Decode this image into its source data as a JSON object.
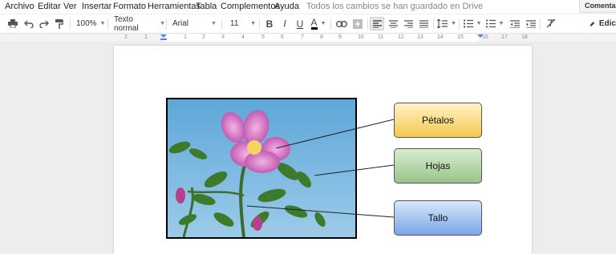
{
  "menu": [
    "Archivo",
    "Editar",
    "Ver",
    "Insertar",
    "Formato",
    "Herramientas",
    "Tabla",
    "Complementos",
    "Ayuda"
  ],
  "save_status": "Todos los cambios se han guardado en Drive",
  "comments_label": "Comentarios",
  "toolbar": {
    "zoom": "100%",
    "style": "Texto normal",
    "font": "Arial",
    "size": "11",
    "edit_label": "Edic",
    "icons": [
      "print-icon",
      "undo-icon",
      "redo-icon",
      "paint-format-icon",
      "bold-icon",
      "italic-icon",
      "underline-icon",
      "text-color-icon",
      "link-icon",
      "insert-comment-icon",
      "align-left-icon",
      "align-center-icon",
      "align-right-icon",
      "justify-icon",
      "line-spacing-icon",
      "numbered-list-icon",
      "bulleted-list-icon",
      "decrease-indent-icon",
      "increase-indent-icon",
      "clear-formatting-icon",
      "pencil-icon"
    ]
  },
  "ruler": {
    "labels": [
      "2",
      "1",
      "1",
      "2",
      "3",
      "4",
      "5",
      "6",
      "7",
      "8",
      "9",
      "10",
      "11",
      "12",
      "13",
      "14",
      "15",
      "16",
      "17",
      "18"
    ]
  },
  "diagram": {
    "labels": [
      "Pétalos",
      "Hojas",
      "Tallo"
    ],
    "colors": {
      "petalos": "#f3c94e",
      "hojas": "#99c489",
      "tallo": "#7aa6e6"
    }
  }
}
